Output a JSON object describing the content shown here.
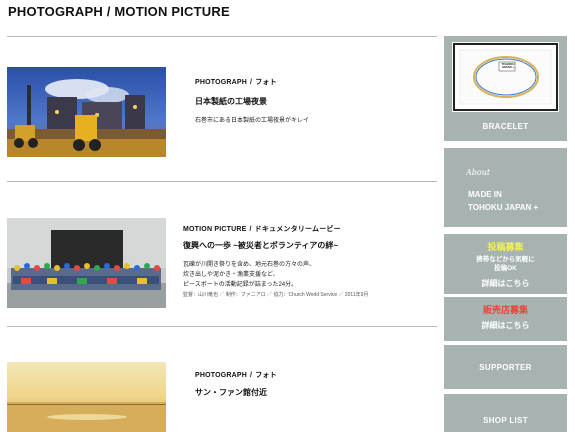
{
  "header": {
    "title": "PHOTOGRAPH / MOTION PICTURE"
  },
  "posts": [
    {
      "category": "PHOTOGRAPH",
      "separator": "/",
      "subcategory": "フォト",
      "title": "日本製紙の工場夜景",
      "description": [
        "石巻市にある日本製紙の工場夜景がキレイ"
      ]
    },
    {
      "category": "MOTION PICTURE",
      "separator": "/",
      "subcategory": "ドキュメンタリームービー",
      "title": "復興への一歩 ~被災者とボランティアの絆~",
      "description": [
        "瓦礫が川開き祭りを含め、地元石巻の方々の声、",
        "炊き出しや泥かき・漁業支援など、",
        "ピースボートの活動記録が詰まった24分。"
      ],
      "credit": "監督：山川竜也 ／ 制作：ファニアロ ／ 協力：Church World Service ／ 2011年9月"
    },
    {
      "category": "PHOTOGRAPH",
      "separator": "/",
      "subcategory": "フォト",
      "title": "サン・ファン館付近",
      "description": []
    }
  ],
  "sidebar": {
    "bracelet_label": "BRACELET",
    "bracelet_frame_text": "TOHOKU JAPAN +",
    "about_script": "About",
    "about_lines": [
      "MADE IN",
      "TOHOKU JAPAN +"
    ],
    "submission_heading": "投稿募集",
    "submission_lines": [
      "携帯などから気軽に",
      "投稿OK"
    ],
    "submission_link": "詳細はこちら",
    "dealer_heading": "販売店募集",
    "dealer_link": "詳細はこちら",
    "supporter_label": "SUPPORTER",
    "shoplist_label": "SHOP LIST"
  }
}
